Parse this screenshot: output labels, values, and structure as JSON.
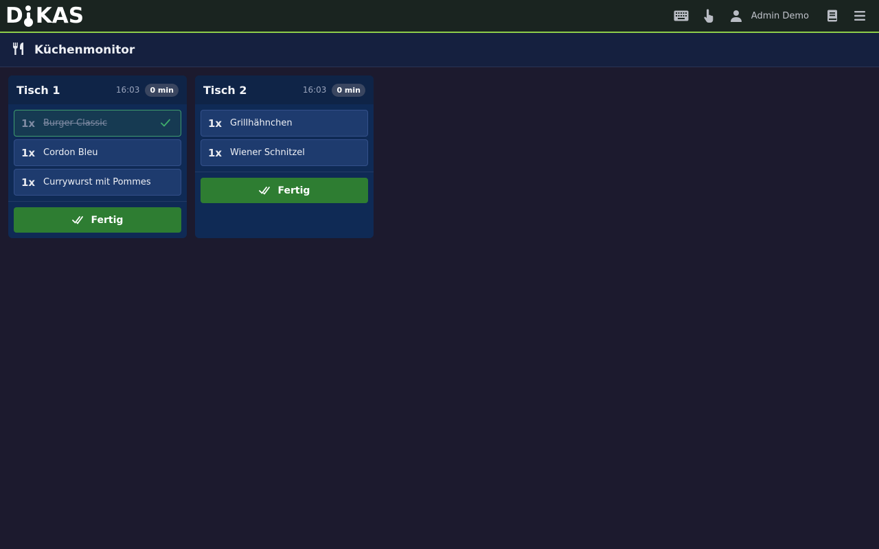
{
  "app": {
    "logo_prefix": "D",
    "logo_suffix": "KAS"
  },
  "topbar": {
    "icons": [
      "keyboard-icon",
      "touch-icon",
      "person-icon",
      "book-icon",
      "menu-icon"
    ],
    "user_name": "Admin Demo"
  },
  "page": {
    "title": "Küchenmonitor",
    "icon": "utensils-icon"
  },
  "colors": {
    "accent_line": "#8fce4a",
    "done_button": "#2e7d32",
    "done_check": "#3fae6c"
  },
  "orders": [
    {
      "table": "Tisch 1",
      "time": "16:03",
      "elapsed": "0 min",
      "items": [
        {
          "qty": "1x",
          "name": "Burger Classic",
          "done": true
        },
        {
          "qty": "1x",
          "name": "Cordon Bleu",
          "done": false
        },
        {
          "qty": "1x",
          "name": "Currywurst mit Pommes",
          "done": false
        }
      ],
      "button": "Fertig"
    },
    {
      "table": "Tisch 2",
      "time": "16:03",
      "elapsed": "0 min",
      "items": [
        {
          "qty": "1x",
          "name": "Grillhähnchen",
          "done": false
        },
        {
          "qty": "1x",
          "name": "Wiener Schnitzel",
          "done": false
        }
      ],
      "button": "Fertig"
    }
  ]
}
